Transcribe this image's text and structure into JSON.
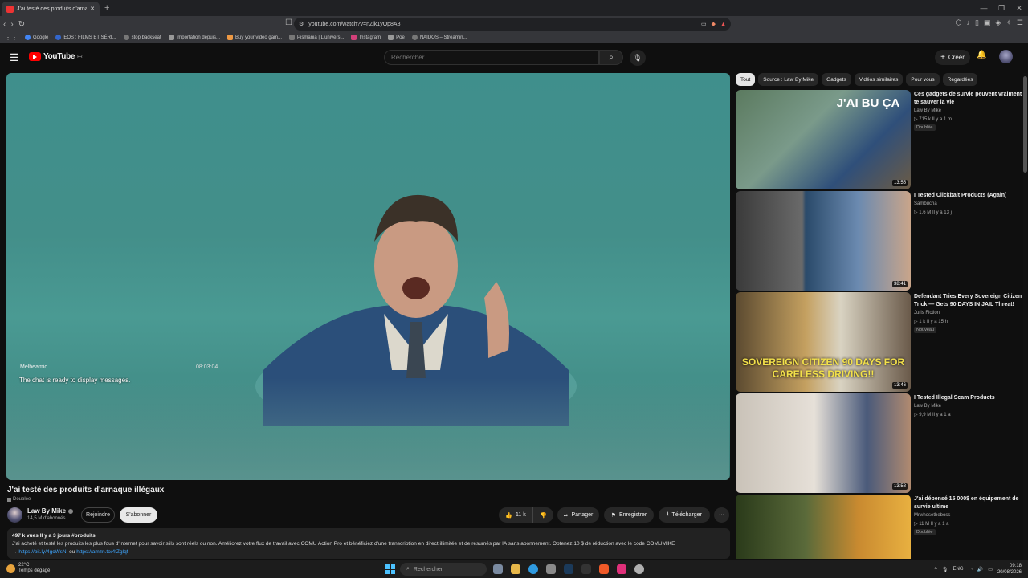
{
  "browser": {
    "tab_title": "J'ai testé des produits d'arna",
    "new_tab": "+",
    "url": "youtube.com/watch?v=nZjk1yOp8A8",
    "window_controls": [
      "—",
      "❐",
      "✕"
    ],
    "bookmarks": [
      {
        "label": "Google",
        "icon": "google-icon"
      },
      {
        "label": "EOS : FILMS ET SÉRI...",
        "icon": "site-icon"
      },
      {
        "label": "stop backseat",
        "icon": "site-icon"
      },
      {
        "label": "Importation depuis...",
        "icon": "folder-icon"
      },
      {
        "label": "Buy your video gam...",
        "icon": "site-icon"
      },
      {
        "label": "Pismania | L'univers...",
        "icon": "site-icon"
      },
      {
        "label": "Instagram",
        "icon": "instagram-icon"
      },
      {
        "label": "Poe",
        "icon": "folder-icon"
      },
      {
        "label": "NAIDOS – Streamin...",
        "icon": "site-icon"
      }
    ]
  },
  "header": {
    "logo": "YouTube",
    "logo_region": "FR",
    "search_placeholder": "Rechercher",
    "create_label": "Créer"
  },
  "player": {
    "chat_name": "Melbeamio",
    "chat_time": "08:03:04",
    "chat_message": "The chat is ready to display messages."
  },
  "video": {
    "title": "J'ai testé des produits d'arnaque illégaux",
    "dubbed": "Doublée",
    "channel": "Law By Mike",
    "subscribers": "14,5 M d'abonnés",
    "join_label": "Rejoindre",
    "subscribe_label": "S'abonner",
    "likes": "11 k",
    "share_label": "Partager",
    "save_label": "Enregistrer",
    "download_label": "Télécharger",
    "more": "···",
    "desc_stats": "497 k vues  Il y a 3 jours  #produits",
    "desc_text": "J'ai acheté et testé les produits les plus fous d'Internet pour savoir s'ils sont réels ou non. Améliorez votre flux de travail avec COMU Action Pro et bénéficiez d'une transcription en direct illimitée et de résumés par IA sans abonnement. Obtenez 10 $ de réduction avec le code COMUMIKE",
    "desc_link_prefix": "→ ",
    "desc_link1": "https://bit.ly/4gcWsNI",
    "desc_or": " ou ",
    "desc_link2": "https://amzn.to/4fZglqf"
  },
  "chips": [
    "Tout",
    "Source : Law By Mike",
    "Gadgets",
    "Vidéos similaires",
    "Pour vous",
    "Regardées"
  ],
  "recommendations": [
    {
      "title": "Ces gadgets de survie peuvent vraiment te sauver la vie",
      "channel": "Law By Mike",
      "meta": "▷ 715 k  Il y a 1 m",
      "badge": "Doublée",
      "duration": "13:55",
      "thumb_text": "J'AI BU ÇA"
    },
    {
      "title": "I Tested Clickbait Products (Again)",
      "channel": "Sambucha",
      "meta": "▷ 1,6 M  Il y a 13 j",
      "badge": "",
      "duration": "38:41",
      "thumb_text": ""
    },
    {
      "title": "Defendant Tries Every Sovereign Citizen Trick — Gets 90 DAYS IN JAIL Threat!",
      "channel": "Juris Fiction",
      "meta": "▷ 1 k  Il y a 15 h",
      "badge": "Nouveau",
      "duration": "13:46",
      "thumb_text": "SOVEREIGN CITIZEN 90 DAYS FOR CARELESS DRIVING!!"
    },
    {
      "title": "I Tested Illegal Scam Products",
      "channel": "Law By Mike",
      "meta": "▷ 9,9 M  Il y a 1 a",
      "badge": "",
      "duration": "13:58",
      "thumb_text": ""
    },
    {
      "title": "J'ai dépensé 15 000$ en équipement de survie ultime",
      "channel": "Mrwhosetheboss",
      "meta": "▷ 11 M  Il y a 1 a",
      "badge": "Doublée",
      "duration": "",
      "thumb_text": ""
    }
  ],
  "taskbar": {
    "temp": "22°C",
    "weather": "Temps dégagé",
    "search": "Rechercher",
    "lang": "ENG",
    "time": "09:18",
    "date": "20/08/2026"
  }
}
